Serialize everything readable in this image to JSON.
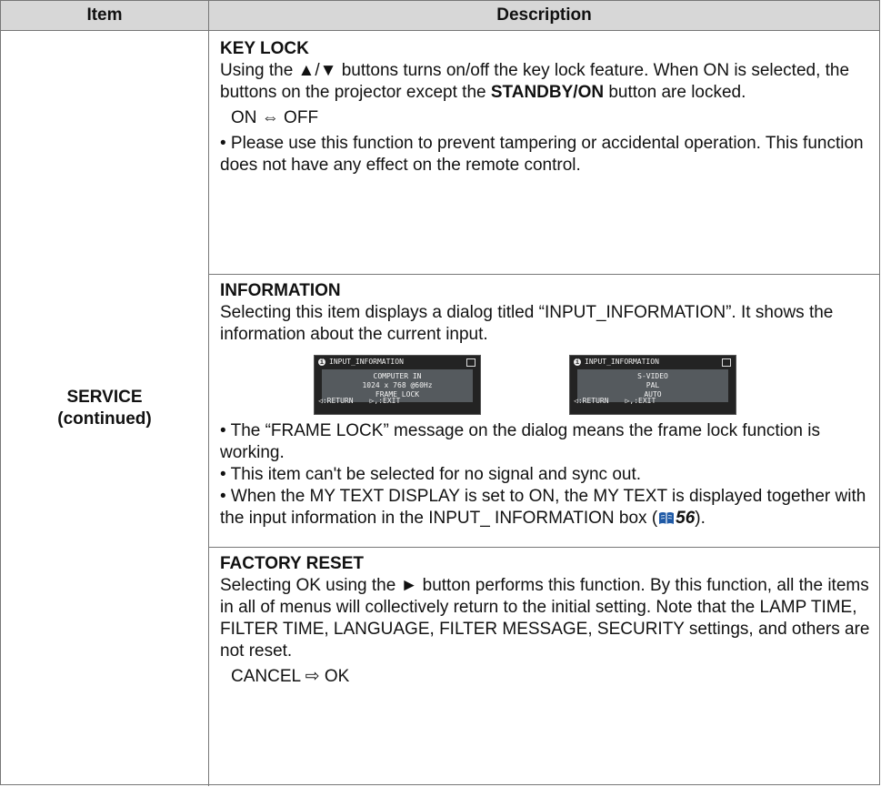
{
  "table": {
    "header": {
      "item": "Item",
      "description": "Description"
    },
    "item_label": {
      "line1": "SERVICE",
      "line2": "(continued)"
    },
    "key_lock": {
      "title": "KEY LOCK",
      "p1_a": "Using the ▲/▼ buttons turns on/off the key lock feature. When ON is selected, the buttons on the projector except the ",
      "p1_bold": "STANDBY/ON",
      "p1_b": " button are locked.",
      "options": "ON ⇔ OFF",
      "note": "• Please use this function to prevent tampering or accidental operation. This function does not have any effect on the remote control."
    },
    "information": {
      "title": "INFORMATION",
      "p1": "Selecting this item displays a dialog titled “INPUT_INFORMATION”. It shows the information about the current input.",
      "dialogs": [
        {
          "title": "INPUT_INFORMATION",
          "lines": [
            "COMPUTER IN",
            "1024 x 768 @60Hz",
            "FRAME LOCK"
          ],
          "return": ":RETURN",
          "exit": ",:EXIT"
        },
        {
          "title": "INPUT_INFORMATION",
          "lines": [
            "S-VIDEO",
            "PAL",
            "AUTO"
          ],
          "return": ":RETURN",
          "exit": ",:EXIT"
        }
      ],
      "note1": "• The “FRAME LOCK” message on the dialog means the frame lock function is working.",
      "note2": "• This item can't be selected for no signal and sync out.",
      "note3_a": "• When the MY TEXT DISPLAY is set to ON, the MY TEXT is displayed together with the input information in the INPUT_ INFORMATION box (",
      "note3_ref": "56",
      "note3_b": ")."
    },
    "factory_reset": {
      "title": "FACTORY RESET",
      "p1": "Selecting OK using the ► button performs this function. By this function, all the items in all of menus will collectively return to the initial setting. Note that the LAMP TIME, FILTER TIME, LANGUAGE, FILTER MESSAGE, SECURITY settings, and others are not reset.",
      "options": "CANCEL ⇨ OK"
    },
    "colors": {
      "header_bg": "#d7d7d7",
      "border": "#777777",
      "ref_icon": "#1f5aa6"
    }
  }
}
